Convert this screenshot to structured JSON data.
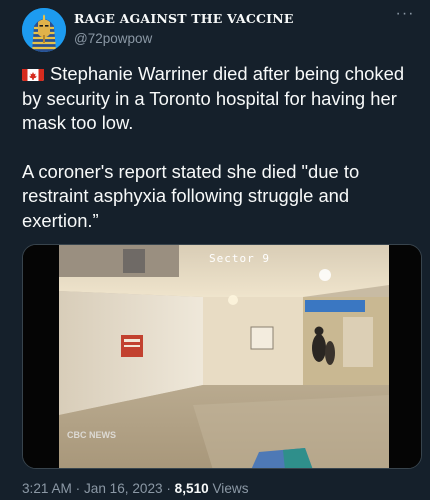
{
  "author": {
    "display_name": "RAGE AGAINST THE VACCINE",
    "handle": "@72powpow"
  },
  "icons": {
    "more": "more-horizontal-icon",
    "flag": "canada-flag-icon"
  },
  "tweet": {
    "paragraph_1": "Stephanie Warriner died after being choked by security in a Toronto hospital for having her mask too low.",
    "paragraph_2": "A coroner's report stated she died \"due to restraint asphyxia following struggle and exertion.”"
  },
  "media": {
    "overlay_text": "Sector 9",
    "watermark": "CBC NEWS"
  },
  "meta": {
    "time": "3:21 AM",
    "separator": " · ",
    "date": "Jan 16, 2023",
    "views_count": "8,510",
    "views_label": "Views"
  },
  "colors": {
    "background": "#15202b",
    "text_primary": "#f7f9f9",
    "text_secondary": "#8b98a5",
    "flag_red": "#d52b1e"
  }
}
